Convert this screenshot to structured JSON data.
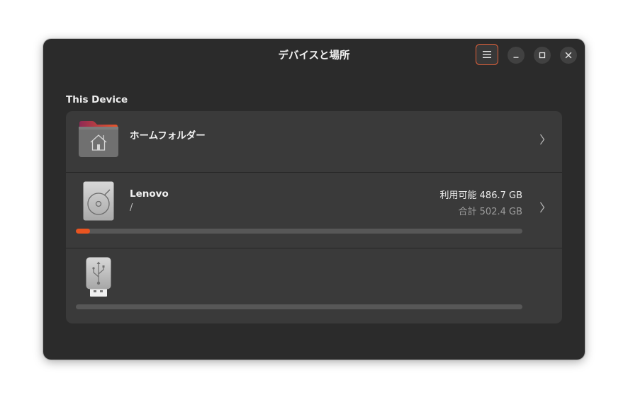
{
  "window": {
    "title": "デバイスと場所",
    "menu_icon": "hamburger-menu-icon",
    "minimize_icon": "minimize-icon",
    "maximize_icon": "maximize-icon",
    "close_icon": "close-icon"
  },
  "section": {
    "label": "This Device"
  },
  "devices": [
    {
      "name": "ホームフォルダー",
      "icon": "home-folder-icon",
      "chevron": "chevron-right-icon"
    },
    {
      "name": "Lenovo",
      "path": "/",
      "icon": "hard-disk-icon",
      "available_label": "利用可能 486.7 GB",
      "total_label": "合計 502.4 GB",
      "used_fraction": 0.031,
      "chevron": "chevron-right-icon"
    },
    {
      "name": "",
      "icon": "usb-drive-icon",
      "used_fraction": 0.0
    }
  ],
  "colors": {
    "accent": "#e95420",
    "window_bg": "#2b2b2b",
    "list_bg": "#3a3a3a",
    "bar_track": "#575757"
  }
}
